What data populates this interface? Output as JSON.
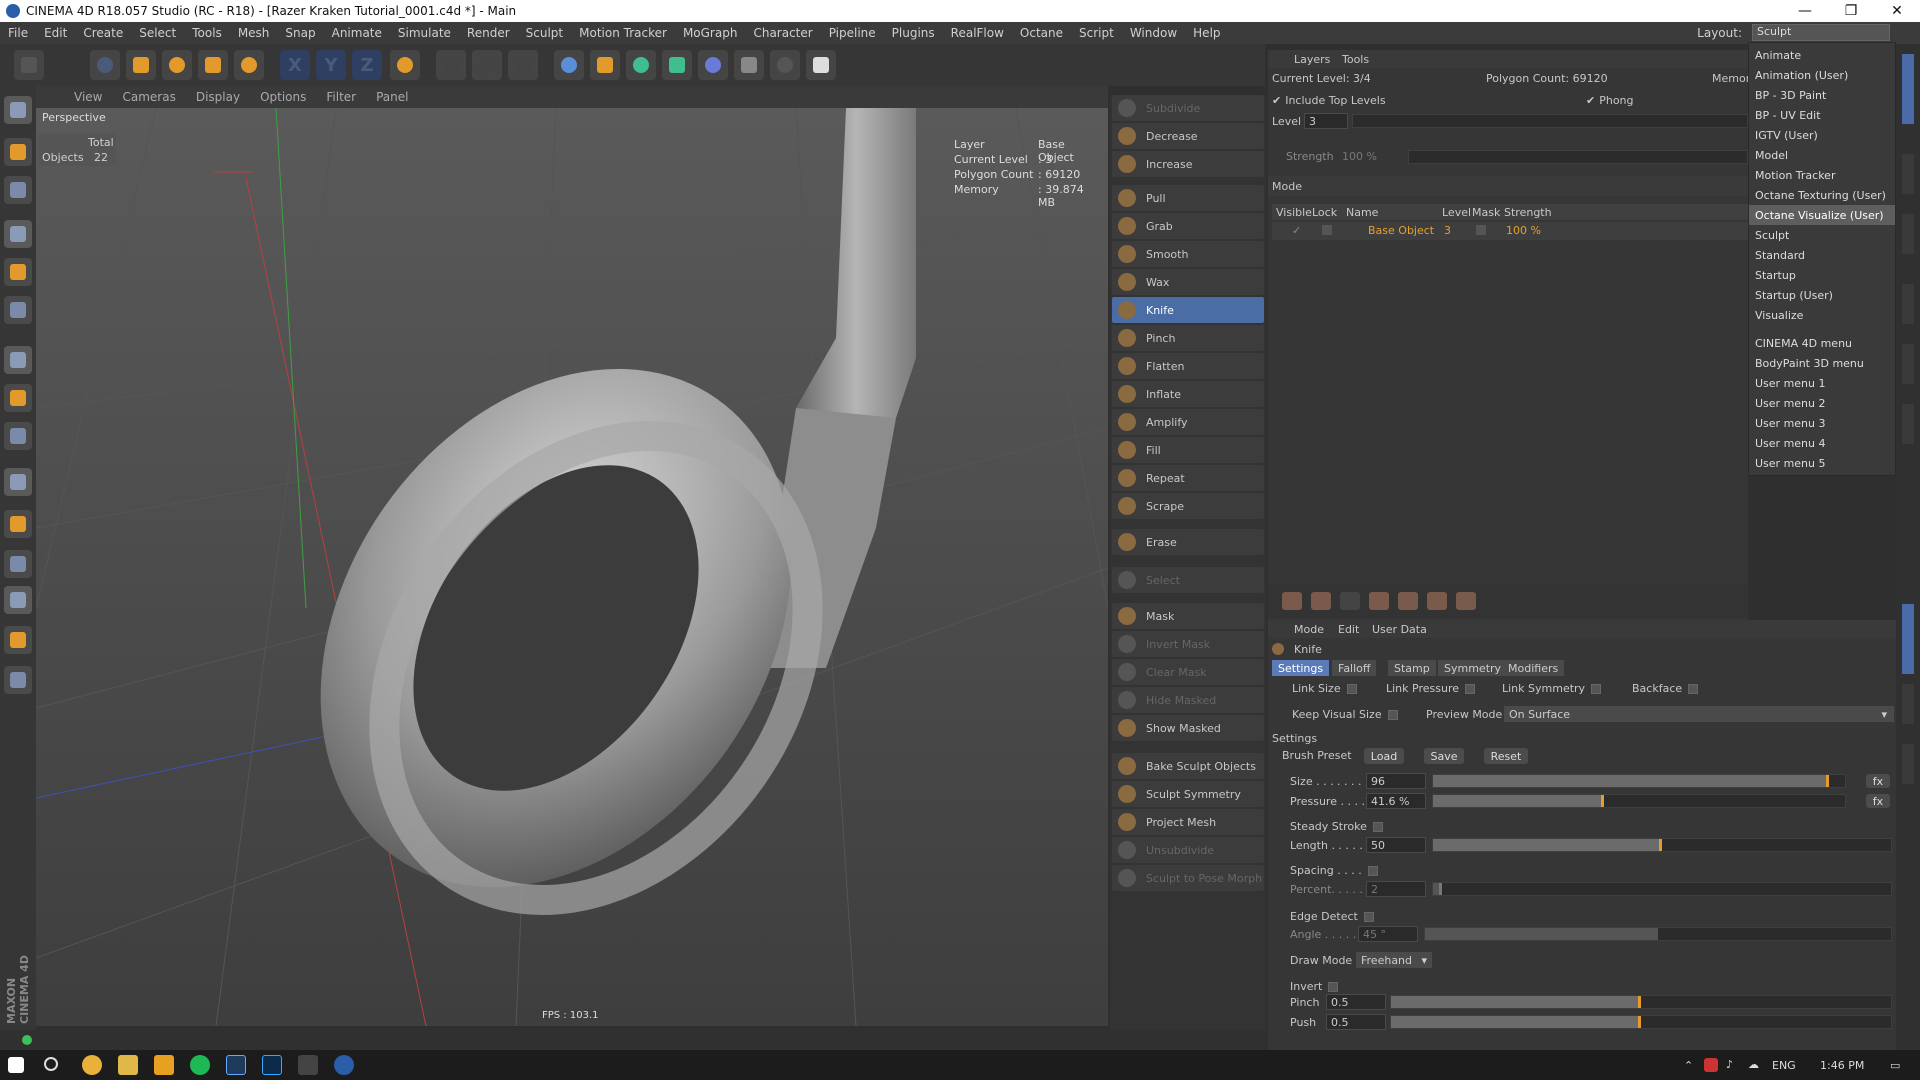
{
  "window": {
    "title": "CINEMA 4D R18.057 Studio (RC - R18) - [Razer Kraken Tutorial_0001.c4d *] - Main",
    "controls": [
      "—",
      "❐",
      "✕"
    ]
  },
  "menubar": {
    "items": [
      "File",
      "Edit",
      "Create",
      "Select",
      "Tools",
      "Mesh",
      "Snap",
      "Animate",
      "Simulate",
      "Render",
      "Sculpt",
      "Motion Tracker",
      "MoGraph",
      "Character",
      "Pipeline",
      "Plugins",
      "RealFlow",
      "Octane",
      "Script",
      "Window",
      "Help"
    ],
    "layout_label": "Layout:",
    "layout_value": "Sculpt"
  },
  "toolbar": {
    "icons": [
      "undo-icon",
      "select-icon",
      "move-icon",
      "scale-icon",
      "rotate-icon",
      "recent-icon",
      "x-axis-icon",
      "y-axis-icon",
      "z-axis-icon",
      "coord-icon",
      "render-view-icon",
      "render-icon",
      "render-settings-icon",
      "cube-icon",
      "pen-icon",
      "subdivision-icon",
      "array-icon",
      "deformer-icon",
      "floor-icon",
      "camera-icon",
      "light-icon"
    ],
    "axis_labels": [
      "X",
      "Y",
      "Z"
    ]
  },
  "viewport": {
    "menu": [
      "View",
      "Cameras",
      "Display",
      "Options",
      "Filter",
      "Panel"
    ],
    "label": "Perspective",
    "stats": {
      "total_label": "Total",
      "objects_label": "Objects",
      "objects_value": "22"
    },
    "info": {
      "layer_label": "Layer",
      "layer_value": "Base Object",
      "level_label": "Current Level",
      "level_value": ": 3",
      "poly_label": "Polygon Count",
      "poly_value": ": 69120",
      "mem_label": "Memory",
      "mem_value": ": 39.874 MB"
    },
    "fps": "FPS : 103.1"
  },
  "sculpt_tools": [
    {
      "label": "Subdivide",
      "dim": true
    },
    {
      "label": "Decrease",
      "dim": false
    },
    {
      "label": "Increase",
      "dim": false
    },
    {
      "label": "Pull",
      "dim": false
    },
    {
      "label": "Grab",
      "dim": false
    },
    {
      "label": "Smooth",
      "dim": false
    },
    {
      "label": "Wax",
      "dim": false
    },
    {
      "label": "Knife",
      "dim": false,
      "selected": true
    },
    {
      "label": "Pinch",
      "dim": false
    },
    {
      "label": "Flatten",
      "dim": false
    },
    {
      "label": "Inflate",
      "dim": false
    },
    {
      "label": "Amplify",
      "dim": false
    },
    {
      "label": "Fill",
      "dim": false
    },
    {
      "label": "Repeat",
      "dim": false
    },
    {
      "label": "Scrape",
      "dim": false
    },
    {
      "label": "Erase",
      "dim": false
    },
    {
      "label": "Select",
      "dim": true
    },
    {
      "label": "Mask",
      "dim": false
    },
    {
      "label": "Invert Mask",
      "dim": true
    },
    {
      "label": "Clear Mask",
      "dim": true
    },
    {
      "label": "Hide Masked",
      "dim": true
    },
    {
      "label": "Show Masked",
      "dim": false
    },
    {
      "label": "Bake Sculpt Objects",
      "dim": false
    },
    {
      "label": "Sculpt Symmetry",
      "dim": false
    },
    {
      "label": "Project Mesh",
      "dim": false
    },
    {
      "label": "Unsubdivide",
      "dim": true
    },
    {
      "label": "Sculpt to Pose Morph",
      "dim": true
    }
  ],
  "layers": {
    "tabs": [
      "Layers",
      "Tools"
    ],
    "current_level": "Current Level: 3/4",
    "polygon_count": "Polygon Count: 69120",
    "memory_cut": "Memor",
    "include_top_levels": "Include Top Levels",
    "phong": "Phong",
    "level_label": "Level",
    "level_value": "3",
    "strength_label": "Strength",
    "strength_value": "100 %",
    "mode_label": "Mode",
    "columns": [
      "Visible",
      "Lock",
      "Name",
      "Level",
      "Mask",
      "Strength"
    ],
    "row": {
      "name": "Base Object",
      "level": "3",
      "strength": "100 %"
    }
  },
  "attributes": {
    "menu": [
      "Mode",
      "Edit",
      "User Data"
    ],
    "tool_name": "Knife",
    "tabs": [
      "Settings",
      "Falloff",
      "Stamp",
      "Symmetry",
      "Modifiers"
    ],
    "link_size": "Link Size",
    "link_pressure": "Link Pressure",
    "link_symmetry": "Link Symmetry",
    "backface": "Backface",
    "keep_visual_size": "Keep Visual Size",
    "preview_mode_label": "Preview Mode",
    "preview_mode_value": "On Surface",
    "settings_header": "Settings",
    "brush_preset": "Brush Preset",
    "load": "Load",
    "save": "Save",
    "reset": "Reset",
    "size_label": "Size . . . . . . .",
    "size_value": "96",
    "size_fraction": 0.96,
    "pressure_label": "Pressure . . . .",
    "pressure_value": "41.6 %",
    "pressure_fraction": 0.416,
    "steady_stroke": "Steady Stroke",
    "length_label": "Length . . . . .",
    "length_value": "50",
    "length_fraction": 0.5,
    "spacing": "Spacing . . . .",
    "percent_label": "Percent. . . . .",
    "percent_value": "2",
    "percent_fraction": 0.02,
    "edge_detect": "Edge Detect",
    "angle_label": "Angle . . . . . .",
    "angle_value": "45 °",
    "angle_fraction": 0.5,
    "draw_mode_label": "Draw Mode",
    "draw_mode_value": "Freehand",
    "invert": "Invert",
    "pinch_label": "Pinch",
    "pinch_value": "0.5",
    "pinch_fraction": 0.5,
    "push_label": "Push",
    "push_value": "0.5",
    "push_fraction": 0.5,
    "fx": "fx"
  },
  "layout_menu": {
    "items": [
      "Animate",
      "Animation (User)",
      "BP - 3D Paint",
      "BP - UV Edit",
      "IGTV (User)",
      "Model",
      "Motion Tracker",
      "Octane Texturing (User)",
      "Octane Visualize (User)",
      "Sculpt",
      "Standard",
      "Startup",
      "Startup (User)",
      "Visualize"
    ],
    "highlighted": "Octane Visualize (User)",
    "items2": [
      "CINEMA 4D menu",
      "BodyPaint 3D menu",
      "User menu 1",
      "User menu 2",
      "User menu 3",
      "User menu 4",
      "User menu 5"
    ]
  },
  "brand": "MAXON CINEMA 4D",
  "taskbar": {
    "lang": "ENG",
    "time": "1:46 PM"
  },
  "colors": {
    "accent": "#5b7bb8",
    "orange": "#e59c2c",
    "object_name": "#e5a12c"
  }
}
